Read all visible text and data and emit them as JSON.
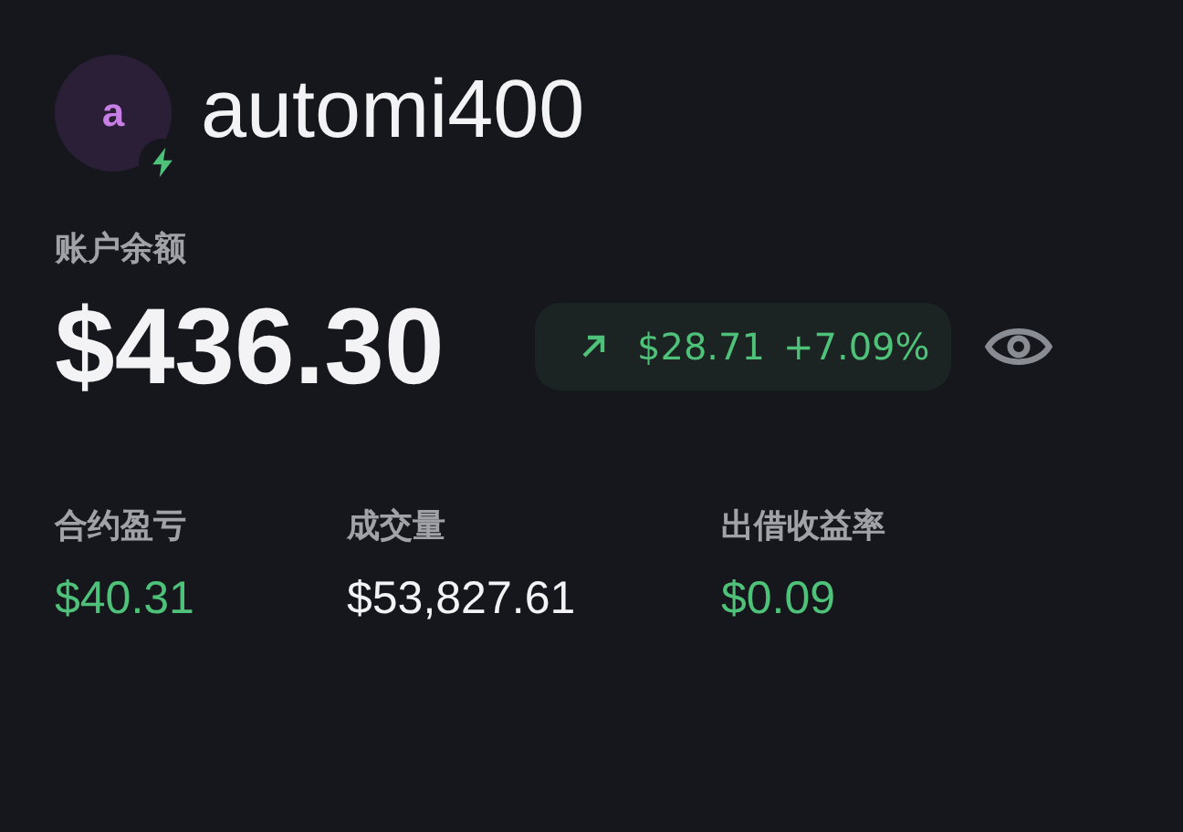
{
  "user": {
    "avatar_letter": "a",
    "name": "automi400"
  },
  "balance": {
    "label": "账户余额",
    "amount": "$436.30",
    "change": {
      "amount": "$28.71",
      "percent": "+7.09%"
    }
  },
  "stats": [
    {
      "label": "合约盈亏",
      "value": "$40.31",
      "kind": "positive"
    },
    {
      "label": "成交量",
      "value": "$53,827.61",
      "kind": "neutral"
    },
    {
      "label": "出借收益率",
      "value": "$0.09",
      "kind": "positive"
    }
  ]
}
